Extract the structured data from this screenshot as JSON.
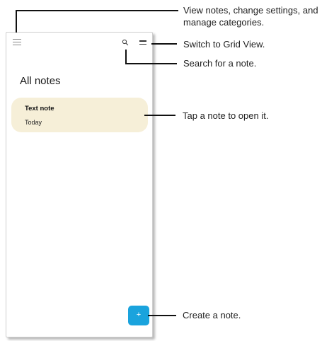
{
  "screen": {
    "title": "All notes",
    "note": {
      "title": "Text note",
      "date": "Today"
    },
    "fab_label": "+"
  },
  "callouts": {
    "menu": "View notes, change settings, and manage categories.",
    "grid": "Switch to Grid View.",
    "search": "Search for a note.",
    "open_note": "Tap a note to open it.",
    "create": "Create a note."
  },
  "colors": {
    "note_card": "#f6efd8",
    "fab": "#1aa3dd",
    "callout_line": "#111111"
  }
}
